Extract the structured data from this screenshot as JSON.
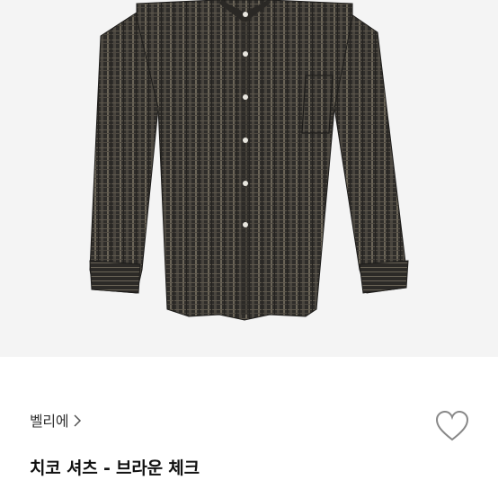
{
  "product": {
    "image_alt": "치코 셔츠 - 브라운 체크",
    "image_background": "#f4f4f4",
    "fabric_color": "#35332f"
  },
  "brand": {
    "name": "벨리에",
    "link_icon": "chevron-right-icon"
  },
  "title": "치코 셔츠 - 브라운 체크",
  "wishlist": {
    "icon": "heart-outline-icon",
    "color": "#888888"
  }
}
